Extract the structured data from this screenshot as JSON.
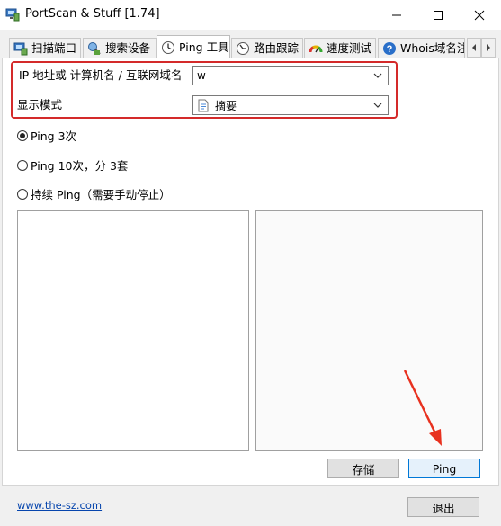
{
  "window": {
    "title": "PortScan & Stuff [1.74]",
    "icons": [
      "app-icon",
      "minimize-icon",
      "maximize-icon",
      "close-icon"
    ]
  },
  "tabs": [
    {
      "label": "扫描端口",
      "icon": "scan-ports-icon",
      "active": false
    },
    {
      "label": "搜索设备",
      "icon": "search-devices-icon",
      "active": false
    },
    {
      "label": "Ping 工具",
      "icon": "ping-tool-icon",
      "active": true
    },
    {
      "label": "路由跟踪",
      "icon": "traceroute-icon",
      "active": false
    },
    {
      "label": "速度测试",
      "icon": "speedtest-icon",
      "active": false
    },
    {
      "label": "Whois域名注",
      "icon": "whois-help-icon",
      "active": false
    }
  ],
  "form": {
    "ip_label": "IP 地址或 计算机名 / 互联网域名",
    "ip_value": "w",
    "mode_label": "显示模式",
    "mode_value": "摘要"
  },
  "options": [
    {
      "label": "Ping 3次",
      "selected": true
    },
    {
      "label": "Ping 10次，分 3套",
      "selected": false
    },
    {
      "label": "持续 Ping（需要手动停止）",
      "selected": false
    }
  ],
  "buttons": {
    "save": "存储",
    "ping": "Ping",
    "exit": "退出"
  },
  "footer": {
    "link": "www.the-sz.com"
  },
  "colors": {
    "highlight": "#d42a2a",
    "arrow": "#e8311f",
    "link": "#0645ad"
  }
}
